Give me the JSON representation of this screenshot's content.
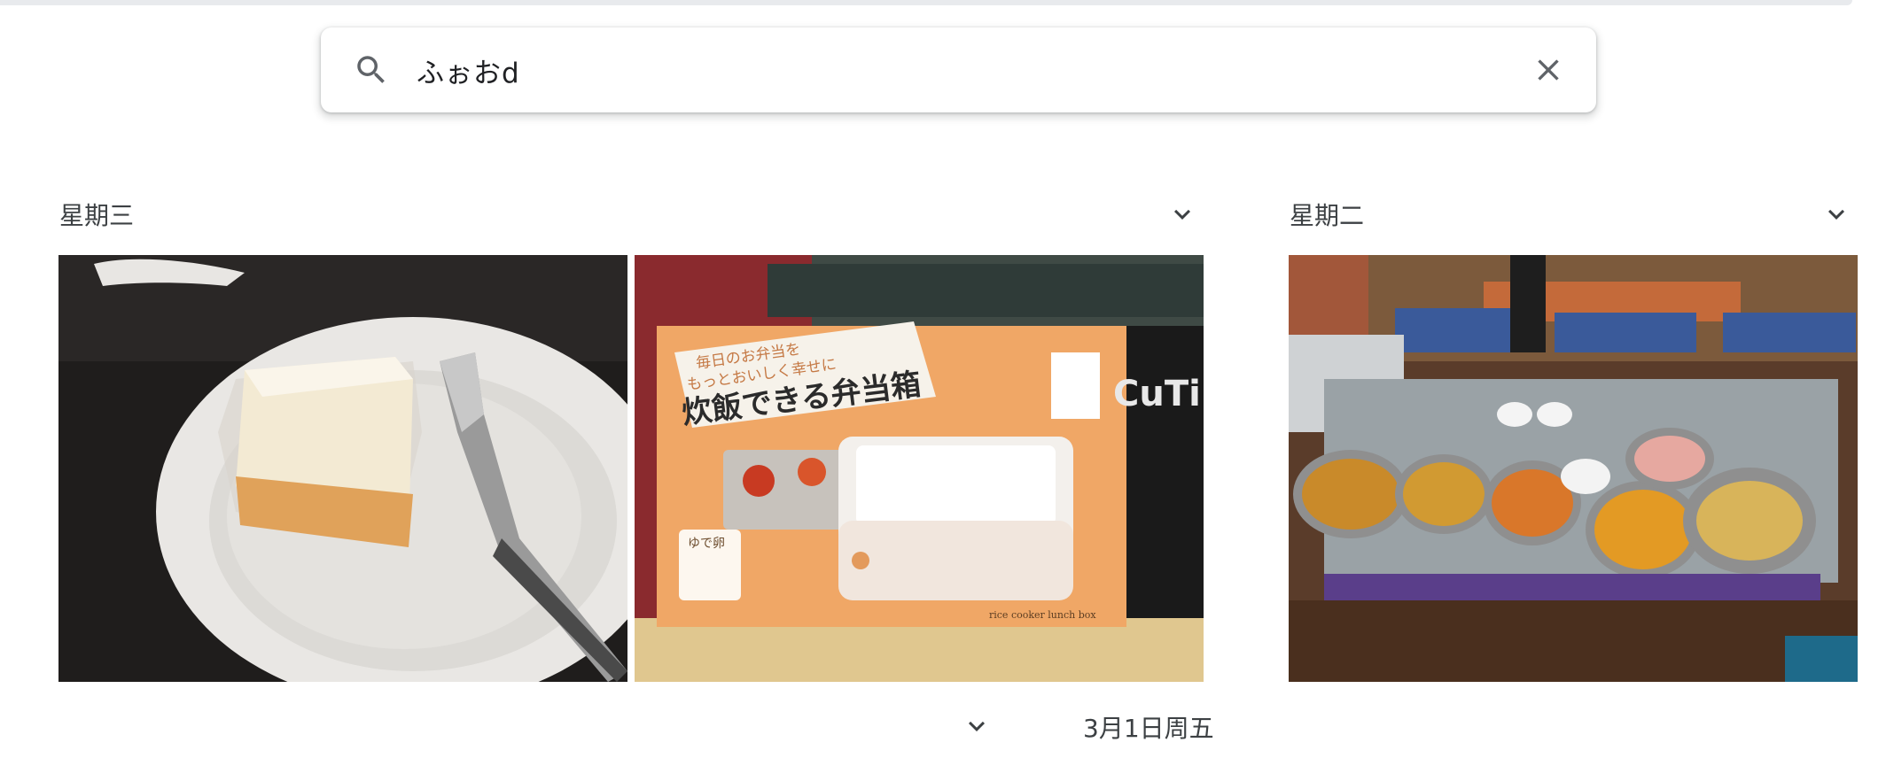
{
  "search": {
    "query": "ふぉおd",
    "icon": "search-icon",
    "clear_icon": "close-icon"
  },
  "groups": [
    {
      "label": "星期三",
      "chevron_icon": "chevron-down-icon",
      "photos": [
        {
          "name": "photo-cheesecake",
          "alt": "cheesecake on plate with fork"
        },
        {
          "name": "photo-rice-cooker-lunch-box",
          "alt": "rice cooker lunch box package"
        }
      ]
    },
    {
      "label": "星期二",
      "chevron_icon": "chevron-down-icon",
      "photos": [
        {
          "name": "photo-curry-buffet",
          "alt": "curry buffet restaurant"
        }
      ]
    }
  ],
  "next_group": {
    "label": "3月1日周五",
    "chevron_icon": "chevron-down-icon"
  },
  "package_text": {
    "line1": "毎日のお弁当を",
    "line2": "もっとおいしく幸せに",
    "title": "炊飯できる弁当箱",
    "egg_label": "ゆで卵",
    "brand": "CuTi",
    "product_en": "rice cooker lunch box"
  },
  "colors": {
    "accent": "#1a73e8",
    "text": "#3c4043",
    "icon": "#5f6368"
  }
}
